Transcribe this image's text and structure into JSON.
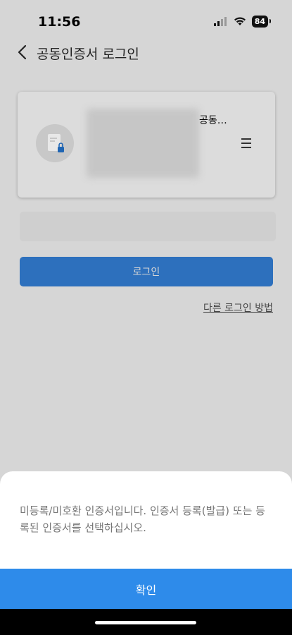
{
  "status": {
    "time": "11:56",
    "battery": "84"
  },
  "header": {
    "title": "공동인증서 로그인"
  },
  "cert": {
    "name": "공동…"
  },
  "password": {
    "placeholder": ""
  },
  "login": {
    "label": "로그인"
  },
  "other_login": {
    "label": "다른 로그인 방법"
  },
  "dialog": {
    "message": "미등록/미호환 인증서입니다. 인증서 등록(발급) 또는 등록된 인증서를 선택하십시오.",
    "confirm_label": "확인"
  },
  "colors": {
    "primary": "#2d70bd",
    "confirm": "#2e8bea",
    "overlay_bg": "#d6d6d6"
  }
}
